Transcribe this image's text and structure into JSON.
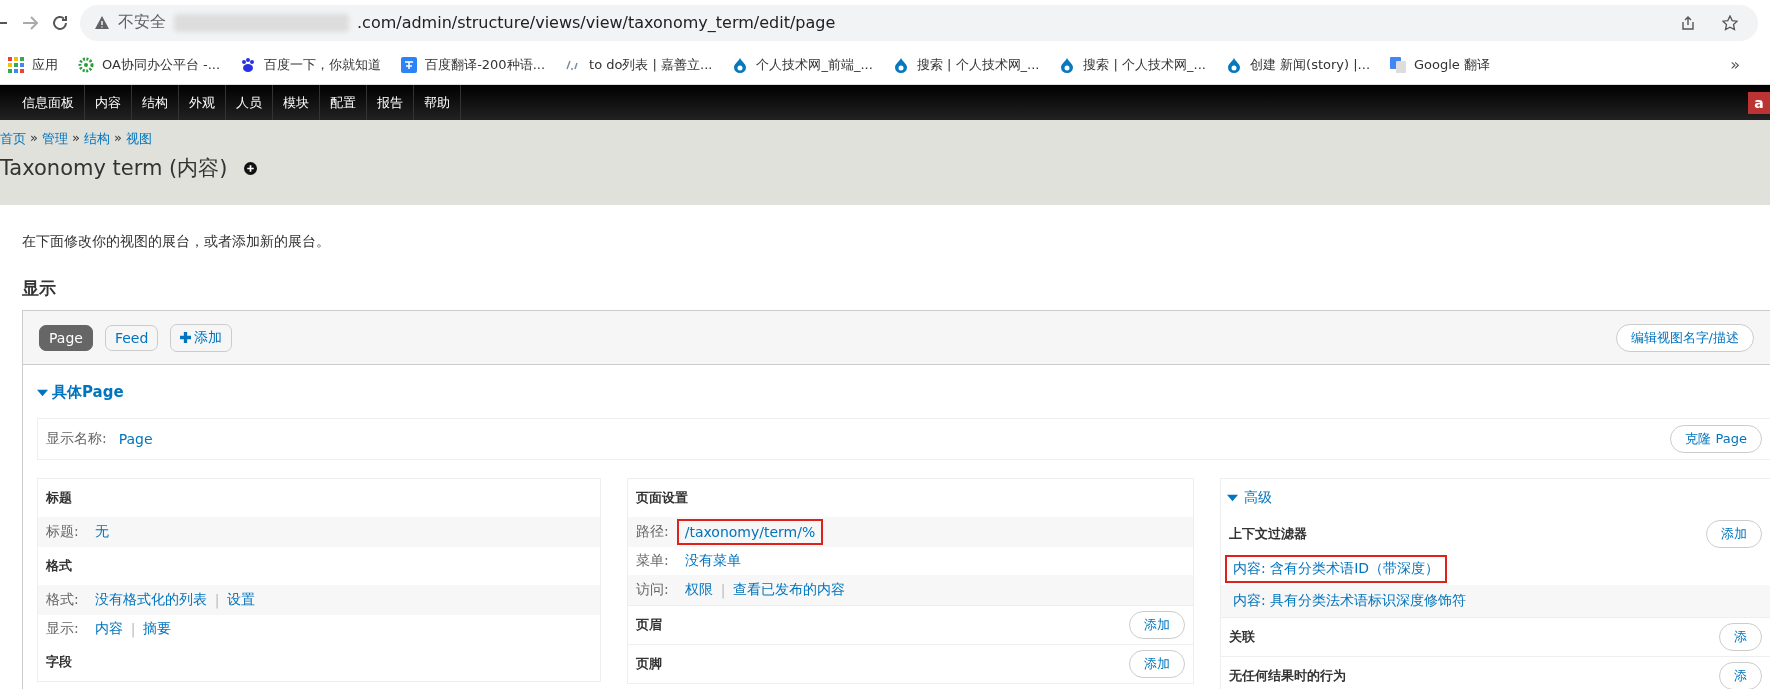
{
  "browser": {
    "security": "不安全",
    "url": ".com/admin/structure/views/view/taxonomy_term/edit/page",
    "bookmarks": [
      {
        "label": "应用",
        "kind": "apps"
      },
      {
        "label": "OA协同办公平台 -...",
        "kind": "gear"
      },
      {
        "label": "百度一下，你就知道",
        "kind": "paw"
      },
      {
        "label": "百度翻译-200种语...",
        "kind": "translate"
      },
      {
        "label": "to do列表 | 嘉善立...",
        "kind": "text"
      },
      {
        "label": "个人技术网_前端_...",
        "kind": "drop"
      },
      {
        "label": "搜索 | 个人技术网_...",
        "kind": "drop"
      },
      {
        "label": "搜索 | 个人技术网_...",
        "kind": "drop"
      },
      {
        "label": "创建 新闻(story) |...",
        "kind": "drop"
      },
      {
        "label": "Google 翻译",
        "kind": "google"
      }
    ],
    "overflow": "»"
  },
  "toolbar": {
    "items": [
      "信息面板",
      "内容",
      "结构",
      "外观",
      "人员",
      "模块",
      "配置",
      "报告",
      "帮助"
    ],
    "user": "a"
  },
  "header": {
    "breadcrumbs": [
      {
        "kind": "link",
        "text": "首页"
      },
      {
        "kind": "sep",
        "text": "»"
      },
      {
        "kind": "link",
        "text": "管理"
      },
      {
        "kind": "sep",
        "text": "»"
      },
      {
        "kind": "link",
        "text": "结构"
      },
      {
        "kind": "sep",
        "text": "»"
      },
      {
        "kind": "link",
        "text": "视图"
      }
    ],
    "title": "Taxonomy term (内容)"
  },
  "description": "在下面修改你的视图的展台，或者添加新的展台。",
  "displays_heading": "显示",
  "display_tabs": [
    {
      "label": "Page",
      "kind": "tab",
      "selected": true
    },
    {
      "label": "Feed",
      "kind": "tab",
      "selected": false
    },
    {
      "label": "添加",
      "kind": "add",
      "selected": false
    }
  ],
  "edit_name_button": "编辑视图名字/描述",
  "section": {
    "title": "具体Page",
    "expanded": true
  },
  "display_name": {
    "label": "显示名称:",
    "value": "Page"
  },
  "clone_button": "克隆 Page",
  "left_column": [
    {
      "title": "标题",
      "rows": [
        {
          "label": "标题:",
          "links": [
            {
              "kind": "link",
              "text": "无"
            }
          ],
          "highlighted": false
        }
      ]
    },
    {
      "title": "格式",
      "rows": [
        {
          "label": "格式:",
          "links": [
            {
              "kind": "link",
              "text": "没有格式化的列表"
            },
            {
              "kind": "sep",
              "text": "|"
            },
            {
              "kind": "link",
              "text": "设置"
            }
          ],
          "highlighted": false
        },
        {
          "label": "显示:",
          "links": [
            {
              "kind": "link",
              "text": "内容"
            },
            {
              "kind": "sep",
              "text": "|"
            },
            {
              "kind": "link",
              "text": "摘要"
            }
          ],
          "highlighted": false
        }
      ]
    },
    {
      "title": "字段"
    }
  ],
  "middle_column": [
    {
      "title": "页面设置",
      "rows": [
        {
          "label": "路径:",
          "links": [
            {
              "kind": "link",
              "text": "/taxonomy/term/%"
            }
          ],
          "highlighted": true
        },
        {
          "label": "菜单:",
          "links": [
            {
              "kind": "link",
              "text": "没有菜单"
            }
          ],
          "highlighted": false
        },
        {
          "label": "访问:",
          "links": [
            {
              "kind": "link",
              "text": "权限"
            },
            {
              "kind": "sep",
              "text": "|"
            },
            {
              "kind": "link",
              "text": "查看已发布的内容"
            }
          ],
          "highlighted": false
        }
      ]
    },
    {
      "title": "页眉",
      "button": "添加"
    },
    {
      "title": "页脚",
      "button": "添加"
    }
  ],
  "advanced": {
    "title": "高级",
    "expanded": true,
    "sections": [
      {
        "title": "上下文过滤器",
        "button": "添加",
        "items": [
          {
            "text": "内容: 含有分类术语ID（带深度）",
            "highlighted": true
          },
          {
            "text": "内容: 具有分类法术语标识深度修饰符",
            "highlighted": false
          }
        ]
      },
      {
        "title": "关联",
        "button": "添"
      },
      {
        "title": "无任何结果时的行为",
        "button": "添"
      }
    ]
  }
}
